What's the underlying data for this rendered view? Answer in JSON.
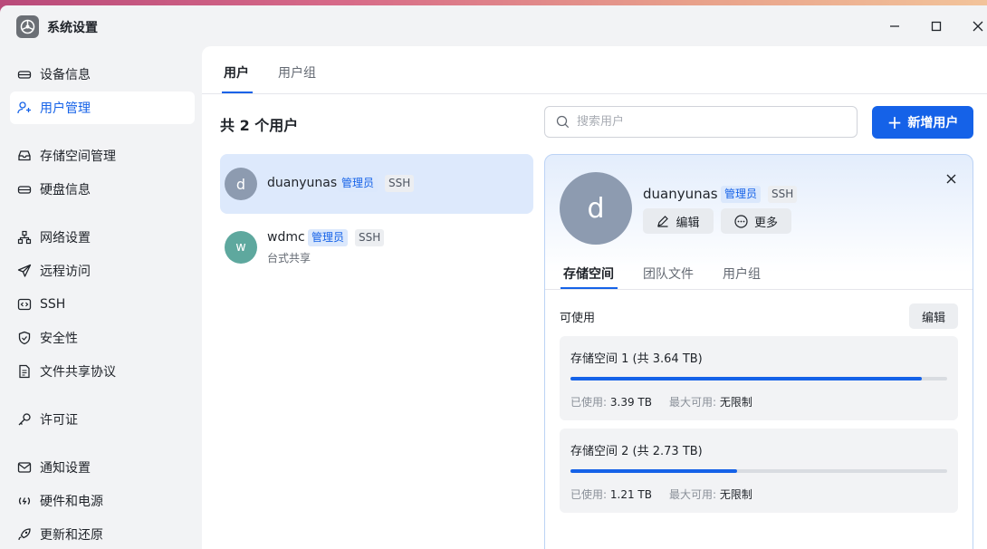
{
  "window": {
    "title": "系统设置"
  },
  "sidebar": {
    "items": [
      {
        "label": "设备信息",
        "icon": "device-icon",
        "active": false
      },
      {
        "label": "用户管理",
        "icon": "users-icon",
        "active": true
      },
      {
        "label": "存储空间管理",
        "icon": "storage-icon",
        "active": false
      },
      {
        "label": "硬盘信息",
        "icon": "disk-icon",
        "active": false
      },
      {
        "label": "网络设置",
        "icon": "network-icon",
        "active": false
      },
      {
        "label": "远程访问",
        "icon": "send-icon",
        "active": false
      },
      {
        "label": "SSH",
        "icon": "code-icon",
        "active": false
      },
      {
        "label": "安全性",
        "icon": "shield-icon",
        "active": false
      },
      {
        "label": "文件共享协议",
        "icon": "document-icon",
        "active": false
      },
      {
        "label": "许可证",
        "icon": "key-icon",
        "active": false
      },
      {
        "label": "通知设置",
        "icon": "mail-icon",
        "active": false
      },
      {
        "label": "硬件和电源",
        "icon": "power-icon",
        "active": false
      },
      {
        "label": "更新和还原",
        "icon": "rocket-icon",
        "active": false
      }
    ]
  },
  "main": {
    "tabs": [
      {
        "label": "用户",
        "active": true
      },
      {
        "label": "用户组",
        "active": false
      }
    ],
    "count_title": "共 2 个用户",
    "search": {
      "placeholder": "搜索用户",
      "value": ""
    },
    "add_button": "新增用户",
    "users": [
      {
        "initial": "d",
        "name": "duanyunas",
        "role": "管理员",
        "tag": "SSH",
        "desc": "",
        "avatar_color": "#8d9bb0",
        "selected": true
      },
      {
        "initial": "w",
        "name": "wdmc",
        "role": "管理员",
        "tag": "SSH",
        "desc": "台式共享",
        "avatar_color": "#5ea89e",
        "selected": false
      }
    ]
  },
  "detail": {
    "initial": "d",
    "name": "duanyunas",
    "role": "管理员",
    "tag": "SSH",
    "edit_label": "编辑",
    "more_label": "更多",
    "tabs": [
      {
        "label": "存储空间",
        "active": true
      },
      {
        "label": "团队文件",
        "active": false
      },
      {
        "label": "用户组",
        "active": false
      }
    ],
    "available_label": "可使用",
    "edit_button": "编辑",
    "storage": [
      {
        "title": "存储空间 1 (共 3.64 TB)",
        "used_label": "已使用:",
        "used": "3.39 TB",
        "max_label": "最大可用:",
        "max": "无限制",
        "fraction": 0.932
      },
      {
        "title": "存储空间 2 (共 2.73 TB)",
        "used_label": "已使用:",
        "used": "1.21 TB",
        "max_label": "最大可用:",
        "max": "无限制",
        "fraction": 0.443
      }
    ]
  },
  "colors": {
    "accent": "#1562e8",
    "sidebar_bg": "#f2f3f5",
    "selected_row": "#dde9fc"
  }
}
